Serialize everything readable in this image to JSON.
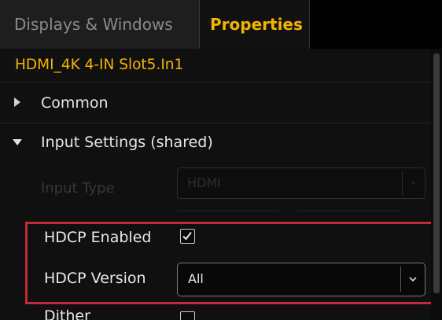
{
  "tabs": [
    {
      "label": "Displays & Windows",
      "active": false
    },
    {
      "label": "Properties",
      "active": true
    }
  ],
  "device_title": "HDMI_4K 4-IN  Slot5.In1",
  "sections": {
    "common": {
      "label": "Common",
      "expanded": false,
      "icon": "triangle-right-icon"
    },
    "input_settings": {
      "label": "Input Settings (shared)",
      "expanded": true,
      "icon": "triangle-down-icon"
    }
  },
  "fields": {
    "input_type": {
      "label": "Input Type",
      "value": "HDMI",
      "disabled": true
    },
    "hdcp_enabled": {
      "label": "HDCP Enabled",
      "checked": true
    },
    "hdcp_version": {
      "label": "HDCP Version",
      "value": "All"
    },
    "dither": {
      "label": "Dither",
      "checked": false
    }
  },
  "icons": {
    "checkbox_check": "checkmark-icon",
    "dropdown_arrow": "chevron-down-icon"
  },
  "colors": {
    "accent": "#f4b400",
    "highlight": "#c22a3a",
    "background": "#101010"
  }
}
